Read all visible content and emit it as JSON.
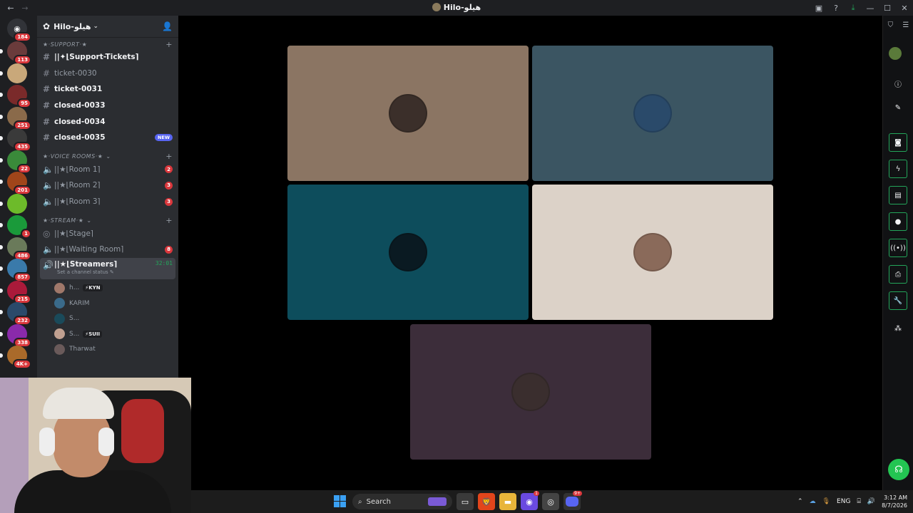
{
  "window": {
    "title": "Hilo-هيلو"
  },
  "rail": {
    "servers": [
      {
        "badge": "184",
        "color": "#5865f2"
      },
      {
        "badge": "113",
        "color": "#6a3b3b"
      },
      {
        "badge": "",
        "color": "#c9a87a"
      },
      {
        "badge": "95",
        "color": "#7a2a2a"
      },
      {
        "badge": "251",
        "color": "#8a6a4a"
      },
      {
        "badge": "435",
        "color": "#3a3a3a"
      },
      {
        "badge": "22",
        "color": "#3a8a3a"
      },
      {
        "badge": "201",
        "color": "#a0451a"
      },
      {
        "badge": "",
        "color": "#6dbb2a"
      },
      {
        "badge": "1",
        "color": "#1a9a3a"
      },
      {
        "badge": "486",
        "color": "#6a7a5a"
      },
      {
        "badge": "857",
        "color": "#3a7aaa"
      },
      {
        "badge": "215",
        "color": "#aa1a3a"
      },
      {
        "badge": "232",
        "color": "#2a4a6a"
      },
      {
        "badge": "338",
        "color": "#8a2aaa"
      },
      {
        "badge": "4K+",
        "color": "#aa6a2a"
      }
    ]
  },
  "sidebar": {
    "guild_name": "Hilo-هيلو",
    "categories": {
      "support": "★·SUPPORT·★",
      "voice": "★·VOICE ROOMS·★",
      "stream": "★·STREAM·★"
    },
    "text_channels": [
      {
        "name": "||✦⌊Support-Tickets⌉",
        "bright": true,
        "marker": "▸"
      },
      {
        "name": "ticket-0030",
        "bright": false
      },
      {
        "name": "ticket-0031",
        "bright": true
      },
      {
        "name": "closed-0033",
        "bright": true
      },
      {
        "name": "closed-0034",
        "bright": true
      },
      {
        "name": "closed-0035",
        "bright": true,
        "new": "NEW"
      }
    ],
    "voice_channels": [
      {
        "name": "||★⌊Room 1⌉",
        "count": "2"
      },
      {
        "name": "||★⌊Room 2⌉",
        "count": "3"
      },
      {
        "name": "||★⌊Room 3⌉",
        "count": "3"
      }
    ],
    "stream_channels": [
      {
        "name": "||★⌊Stage⌉",
        "count": ""
      },
      {
        "name": "||★⌊Waiting Room⌉",
        "count": "8"
      }
    ],
    "active_channel": {
      "name": "||★⌊Streamers⌉",
      "timer": "32:01",
      "status": "Set a channel status"
    },
    "members": [
      {
        "name": "h...",
        "tag": "⚡KYN",
        "color": "#a0786a"
      },
      {
        "name": "KARIM",
        "tag": "",
        "color": "#3a6a8a"
      },
      {
        "name": "S...",
        "tag": "",
        "color": "#1a4a5a"
      },
      {
        "name": "S...",
        "tag": "⚡SUII",
        "color": "#c0a090"
      },
      {
        "name": "Tharwat",
        "tag": "",
        "color": "#6a5a5a"
      }
    ]
  },
  "video": {
    "tiles": [
      {
        "bg": "#8b7563",
        "avatar": "#3b2f2a"
      },
      {
        "bg": "#3b5562",
        "avatar": "#2a4a6a"
      },
      {
        "bg": "#0d4d5c",
        "avatar": "#0a1a22"
      },
      {
        "bg": "#dcd2c8",
        "avatar": "#8a6a5a"
      },
      {
        "bg": "#3c2d3a",
        "avatar": "#3a2e2e"
      }
    ]
  },
  "taskbar": {
    "search_label": "Search",
    "lang": "ENG",
    "time": "3:12 AM",
    "date": "8/7/2026"
  },
  "colors": {
    "accent_green": "#23a55a",
    "badge_red": "#da373c",
    "blurple": "#5865f2"
  }
}
